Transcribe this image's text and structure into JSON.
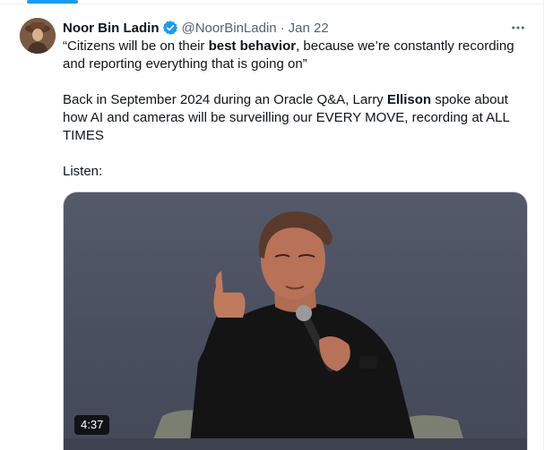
{
  "tweet": {
    "author_name": "Noor Bin Ladin",
    "handle": "@NoorBinLadin",
    "separator": "·",
    "date": "Jan 22",
    "more_icon": "more-horizontal-icon",
    "verified_icon": "verified-badge-icon",
    "colors": {
      "accent": "#1d9bf0",
      "text": "#0f1419",
      "secondary": "#536471"
    },
    "quote": {
      "part1": "“Citizens will be on their ",
      "bold": "best behavior",
      "part2": ", because we’re constantly recording and reporting everything that is going on”"
    },
    "body": {
      "part1": "Back in September 2024 during an Oracle Q&A, Larry ",
      "bold": "Ellison",
      "part2": " spoke about how AI and cameras will be surveilling our EVERY MOVE, recording at ALL TIMES"
    },
    "listen": "Listen:",
    "media": {
      "duration": "4:37"
    }
  }
}
